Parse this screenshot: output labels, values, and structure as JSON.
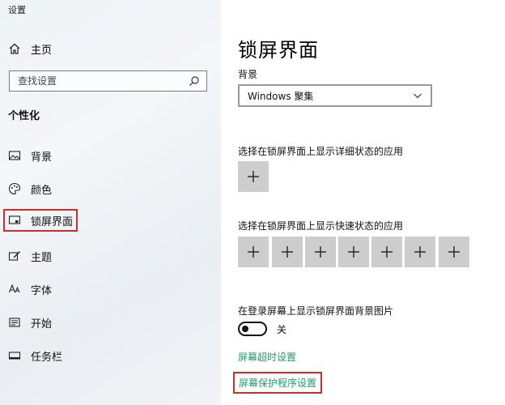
{
  "window": {
    "title": "设置"
  },
  "sidebar": {
    "home_label": "主页",
    "search_placeholder": "查找设置",
    "section_title": "个性化",
    "items": [
      {
        "label": "背景",
        "icon": "image-icon"
      },
      {
        "label": "颜色",
        "icon": "palette-icon"
      },
      {
        "label": "锁屏界面",
        "icon": "lock-screen-icon",
        "selected": true
      },
      {
        "label": "主题",
        "icon": "theme-brush-icon"
      },
      {
        "label": "字体",
        "icon": "font-icon"
      },
      {
        "label": "开始",
        "icon": "start-icon"
      },
      {
        "label": "任务栏",
        "icon": "taskbar-icon"
      }
    ]
  },
  "main": {
    "title": "锁屏界面",
    "background_label": "背景",
    "background_value": "Windows 聚集",
    "detailed_status_label": "选择在锁屏界面上显示详细状态的应用",
    "quick_status_label": "选择在锁屏界面上显示快速状态的应用",
    "show_bg_on_signin_label": "在登录屏幕上显示锁屏界面背景图片",
    "toggle_state": "关",
    "toggle_on": false,
    "screen_timeout_link": "屏幕超时设置",
    "screensaver_link": "屏幕保护程序设置"
  },
  "colors": {
    "accent_link": "#1e9e6a",
    "highlight_box": "#c9302c",
    "plus_tile": "#cdcdcd"
  }
}
